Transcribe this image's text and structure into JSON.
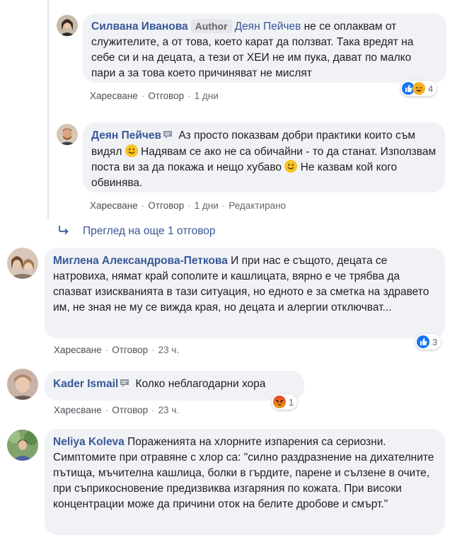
{
  "comments": [
    {
      "author": "Силвана Иванова",
      "badge": "Author",
      "mention": "Деян Пейчев",
      "text": " не се оплаквам от служителите, а от това, което карат да ползват. Така вредят на себе си и на децата, а тези от ХЕИ не им пука, дават по малко пари а за това което причиняват не мислят",
      "actions": {
        "like": "Харесване",
        "reply": "Отговор",
        "time": "1 дни"
      },
      "reactions": {
        "types": [
          "like-icon",
          "haha-icon"
        ],
        "count": "4"
      }
    },
    {
      "author": "Деян Пейчев",
      "text_1": " Аз просто показвам добри практики които съм видял ",
      "text_2": " Надявам се ако не са обичайни - то да станат. Използвам поста ви за да покажа и нещо хубаво ",
      "text_3": " Не казвам кой кого обвинява.",
      "actions": {
        "like": "Харесване",
        "reply": "Отговор",
        "time": "1 дни",
        "edited": "Редактирано"
      }
    },
    {
      "author": "Миглена Александрова-Петкова",
      "text": " И при нас е същото, децата се натровиха, нямат край сополите и кашлицата, вярно е че трябва да спазват изискванията в тази ситуация, но едното е за сметка на здравето им, не зная не му се вижда края, но децата и алергии отключват...",
      "actions": {
        "like": "Харесване",
        "reply": "Отговор",
        "time": "23 ч."
      },
      "reactions": {
        "types": [
          "like-icon"
        ],
        "count": "3"
      }
    },
    {
      "author": "Kader Ismail",
      "text": " Колко неблагодарни хора",
      "actions": {
        "like": "Харесване",
        "reply": "Отговор",
        "time": "23 ч."
      },
      "reactions": {
        "types": [
          "angry-icon"
        ],
        "count": "1"
      }
    },
    {
      "author": "Neliya Koleva",
      "text": " Пораженията на хлорните изпарения са сериозни. Симптомите при отравяне с хлор са: \"силно раздразнение на дихателните пътища, мъчителна кашлица, болки в гърдите, парене и сълзене в очите, при съприкосновение предизвиква изгаряния по кожата. При високи концентрации може да причини оток на белите дробове и смърт.\""
    }
  ],
  "more_replies": "Преглед на още 1 отговор",
  "colors": {
    "link": "#385898",
    "bubble": "#f0f2f5",
    "meta": "#65676b",
    "like": "#1877f2",
    "angry": "#e9710f"
  }
}
